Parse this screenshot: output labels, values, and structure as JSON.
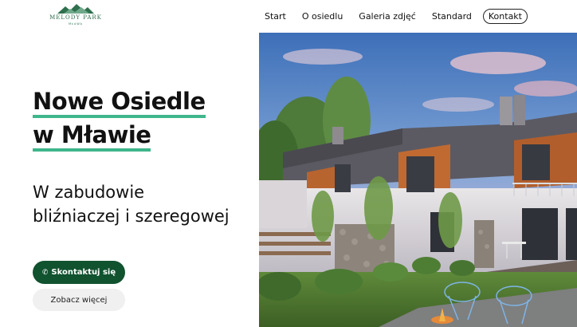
{
  "logo": {
    "name": "MELODY PARK",
    "sub": "MŁAWA"
  },
  "nav": {
    "items": [
      {
        "label": "Start"
      },
      {
        "label": "O osiedlu"
      },
      {
        "label": "Galeria zdjęć"
      },
      {
        "label": "Standard"
      }
    ],
    "contact_label": "Kontakt"
  },
  "hero": {
    "title_line1": "Nowe Osiedle",
    "title_line2": "w Mławie",
    "subtitle_line1": "W zabudowie",
    "subtitle_line2": "bliźniaczej i szeregowej",
    "primary_button": "Skontaktuj się",
    "secondary_button": "Zobacz więcej"
  },
  "colors": {
    "accent_underline": "#3fb68b",
    "primary_button": "#11522f",
    "brand_green": "#2e6f4e"
  },
  "icons": {
    "phone": "phone-icon"
  }
}
